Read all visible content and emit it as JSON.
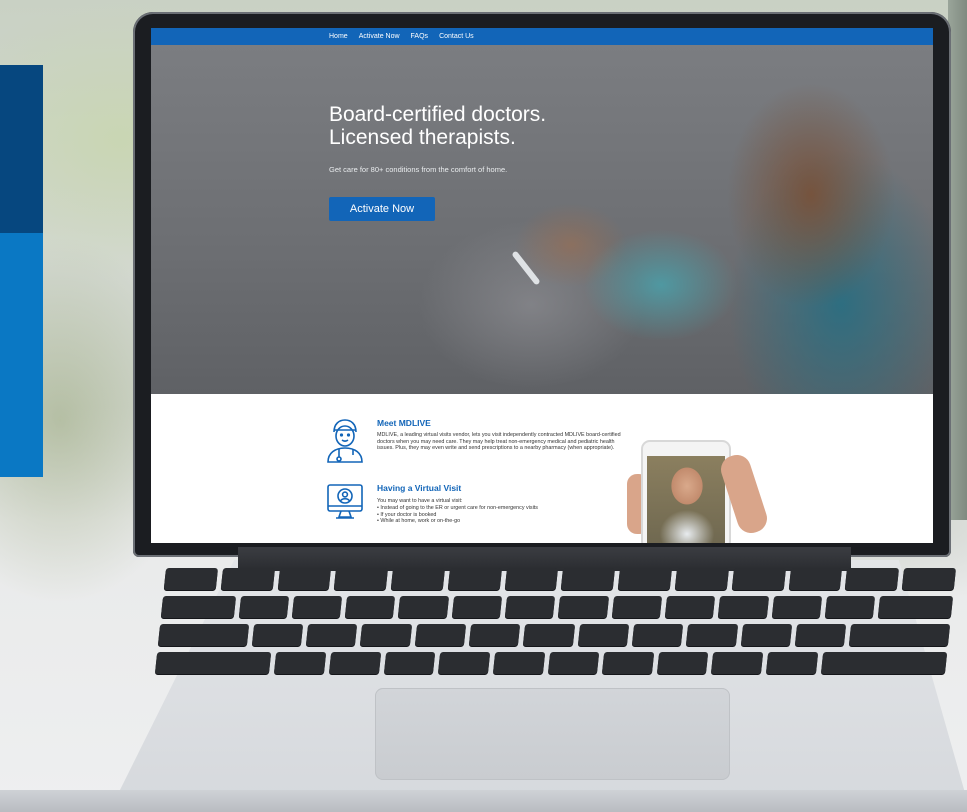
{
  "nav": {
    "items": [
      "Home",
      "Activate Now",
      "FAQs",
      "Contact Us"
    ]
  },
  "hero": {
    "title_line1": "Board-certified doctors.",
    "title_line2": "Licensed therapists.",
    "subtitle": "Get care for 80+ conditions from the comfort of home.",
    "cta": "Activate Now"
  },
  "meet": {
    "title": "Meet MDLIVE",
    "body": "MDLIVE, a leading virtual visits vendor, lets you visit independently contracted MDLIVE board-certified doctors when you may need care. They may help treat non-emergency medical and pediatric health issues. Plus, they may even write and send prescriptions to a nearby pharmacy (when appropriate)."
  },
  "visit": {
    "title": "Having a Virtual Visit",
    "intro": "You may want to have a virtual visit:",
    "bullets": [
      "Instead of going to the ER or urgent care for non-emergency visits",
      "If your doctor is booked",
      "While at home, work or on-the-go"
    ]
  },
  "colors": {
    "brand_blue": "#1265b8",
    "dark_blue": "#06477f",
    "light_blue": "#0a78c4"
  },
  "icons": {
    "doctor": "doctor-icon",
    "computer": "computer-user-icon"
  }
}
